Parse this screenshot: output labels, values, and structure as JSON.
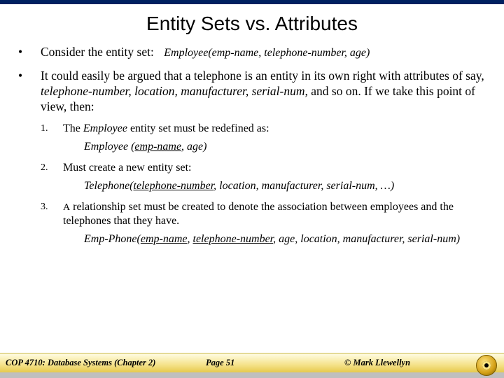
{
  "title": "Entity Sets vs. Attributes",
  "bullets": [
    {
      "lead": "Consider the entity set:",
      "sig": "Employee(emp-name, telephone-number, age)"
    },
    {
      "text_parts": {
        "a": "It could easily be argued that a telephone is an entity in its own right with attributes of say, ",
        "b": "telephone-number, location, manufacturer, serial-num,",
        "c": " and so on.  If we take this point of view, then:"
      }
    }
  ],
  "numbered": [
    {
      "idx": "1.",
      "parts": {
        "a": "The ",
        "b": "Employee",
        "c": " entity set must be redefined as:"
      },
      "def": {
        "pre": "Employee (",
        "u": "emp-name",
        "post": ", age)"
      }
    },
    {
      "idx": "2.",
      "text": "Must create a new entity set:",
      "def": {
        "pre": "Telephone(",
        "u": "telephone-number",
        "post": ", location, manufacturer, serial-num, …)"
      }
    },
    {
      "idx": "3.",
      "parts": {
        "a": "A",
        "b": " relationship set must be created to denote the association between employees and the telephones that they have."
      },
      "def": {
        "pre": "Emp-Phone(",
        "u1": "emp-name",
        "mid": ", ",
        "u2": "telephone-number",
        "post": ", age, location, manufacturer, serial-num)"
      }
    }
  ],
  "footer": {
    "left": "COP 4710: Database Systems  (Chapter 2)",
    "center": "Page 51",
    "right": "© Mark Llewellyn"
  }
}
